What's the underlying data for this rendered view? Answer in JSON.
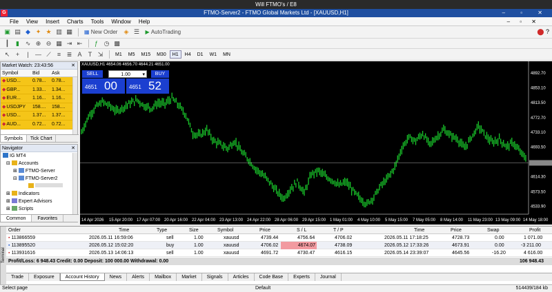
{
  "window": {
    "top_title": "Will FTMO's / E8",
    "app_title": "FTMO-Server2 - FTMO Global Markets Ltd - [XAUUSD,H1]",
    "app_icon": "G",
    "controls": "–  ▫  ✕"
  },
  "menu": {
    "items": [
      "File",
      "View",
      "Insert",
      "Charts",
      "Tools",
      "Window",
      "Help"
    ],
    "right": "– ▫ ✕"
  },
  "toolbar": {
    "new_order_label": "New Order",
    "autotrading_label": "AutoTrading",
    "timeframes": [
      "M1",
      "M5",
      "M15",
      "M30",
      "H1",
      "H4",
      "D1",
      "W1",
      "MN"
    ],
    "active_timeframe": "H1"
  },
  "market_watch": {
    "title": "Market Watch: 23:43:56",
    "columns": [
      "Symbol",
      "Bid",
      "Ask"
    ],
    "rows": [
      {
        "symbol": "USD...",
        "bid": "0.78...",
        "ask": "0.78..."
      },
      {
        "symbol": "GBP...",
        "bid": "1.33...",
        "ask": "1.34..."
      },
      {
        "symbol": "EUR...",
        "bid": "1.16...",
        "ask": "1.16..."
      },
      {
        "symbol": "USDJPY",
        "bid": "158....",
        "ask": "158...."
      },
      {
        "symbol": "USD...",
        "bid": "1.37...",
        "ask": "1.37..."
      },
      {
        "symbol": "AUD...",
        "bid": "0.72...",
        "ask": "0.72..."
      }
    ],
    "tabs": [
      "Symbols",
      "Tick Chart"
    ]
  },
  "navigator": {
    "title": "Navigator",
    "items": [
      {
        "label": "IG MT4",
        "level": 0
      },
      {
        "label": "Accounts",
        "level": 1
      },
      {
        "label": "FTMO-Server",
        "level": 2
      },
      {
        "label": "FTMO-Server2",
        "level": 2
      },
      {
        "label": "",
        "level": 3
      },
      {
        "label": "Indicators",
        "level": 1
      },
      {
        "label": "Expert Advisors",
        "level": 1
      },
      {
        "label": "Scripts",
        "level": 1
      }
    ],
    "tabs": [
      "Common",
      "Favorites"
    ]
  },
  "one_click": {
    "sell_label": "SELL",
    "buy_label": "BUY",
    "lot": "1.00",
    "sell_small": "4651",
    "sell_big": "00",
    "buy_small": "4651",
    "buy_big": "52"
  },
  "chart_data": {
    "type": "line",
    "symbol_info": "XAUUSD,H1  4654.06 4656.70 4644.21 4651.00",
    "ylim": [
      4513,
      4902
    ],
    "y_ticks": [
      "4892.70",
      "4853.10",
      "4813.50",
      "4772.70",
      "4733.10",
      "4693.50",
      "4651.00",
      "4614.30",
      "4573.50",
      "4533.90"
    ],
    "current_price": 4651.0,
    "x_ticks": [
      "14 Apr 2026",
      "15 Apr 20:00",
      "17 Apr 07:00",
      "20 Apr 16:00",
      "22 Apr 04:00",
      "23 Apr 13:00",
      "24 Apr 22:00",
      "28 Apr 06:00",
      "29 Apr 15:00",
      "1 May 01:00",
      "4 May 10:00",
      "5 May 15:00",
      "7 May 05:00",
      "8 May 14:00",
      "11 May 23:00",
      "13 May 09:00",
      "14 May 18:00"
    ],
    "series": [
      {
        "values": [
          4733,
          4775,
          4800,
          4815,
          4805,
          4790,
          4800,
          4812,
          4820,
          4805,
          4798,
          4812,
          4810,
          4825,
          4805,
          4780,
          4730,
          4725,
          4740,
          4710,
          4700,
          4690,
          4710,
          4680,
          4660,
          4635,
          4620,
          4600,
          4575,
          4555,
          4580,
          4600,
          4570,
          4620,
          4630,
          4615,
          4605,
          4590,
          4600,
          4575,
          4555,
          4540,
          4560,
          4590,
          4610,
          4640,
          4690,
          4720,
          4710,
          4730,
          4700,
          4720,
          4740,
          4725,
          4715,
          4690,
          4720,
          4750,
          4725,
          4705,
          4715,
          4695,
          4705,
          4680,
          4660
        ]
      }
    ]
  },
  "terminal": {
    "side_label": "Terminal",
    "columns": [
      "Order",
      "Time",
      "Type",
      "Size",
      "Symbol",
      "Price",
      "S / L",
      "T / P",
      "Time",
      "Price",
      "Swap",
      "Profit"
    ],
    "rows": [
      {
        "order": "113866559",
        "time": "2026.05.11 16:59:06",
        "type": "sell",
        "size": "1.00",
        "symbol": "xauusd",
        "price": "4739.44",
        "sl": "4756.64",
        "tp": "4706.02",
        "time2": "2026.05.11 17:18:25",
        "price2": "4728.73",
        "swap": "0.00",
        "profit": "1 071.00"
      },
      {
        "order": "113895520",
        "time": "2026.05.12 15:02:20",
        "type": "buy",
        "size": "1.00",
        "symbol": "xauusd",
        "price": "4706.02",
        "sl": "4674.07",
        "tp": "4738.09",
        "time2": "2026.05.12 17:33:26",
        "price2": "4673.91",
        "swap": "0.00",
        "profit": "-3 211.00"
      },
      {
        "order": "113931616",
        "time": "2026.05.13 14:06:13",
        "type": "sell",
        "size": "1.00",
        "symbol": "xauusd",
        "price": "4691.72",
        "sl": "4730.47",
        "tp": "4616.15",
        "time2": "2026.05.14 23:39:07",
        "price2": "4645.56",
        "swap": "-16.20",
        "profit": "4 616.00"
      }
    ],
    "summary": "Profit/Loss: 6 948.43  Credit: 0.00  Deposit: 100 000.00  Withdrawal: 0.00",
    "summary_total": "106 948.43",
    "tabs": [
      "Trade",
      "Exposure",
      "Account History",
      "News",
      "Alerts",
      "Mailbox",
      "Market",
      "Signals",
      "Articles",
      "Code Base",
      "Experts",
      "Journal"
    ],
    "active_tab": "Account History"
  },
  "status": {
    "left": "Select page",
    "middle": "Default",
    "right": "514439/184 kb"
  },
  "colors": {
    "candle": "#19c62a",
    "chart_bg": "#000000",
    "watch_row": "#f5c518",
    "sl_highlight": "#f29aa0",
    "one_click": "#1b3fd0"
  }
}
